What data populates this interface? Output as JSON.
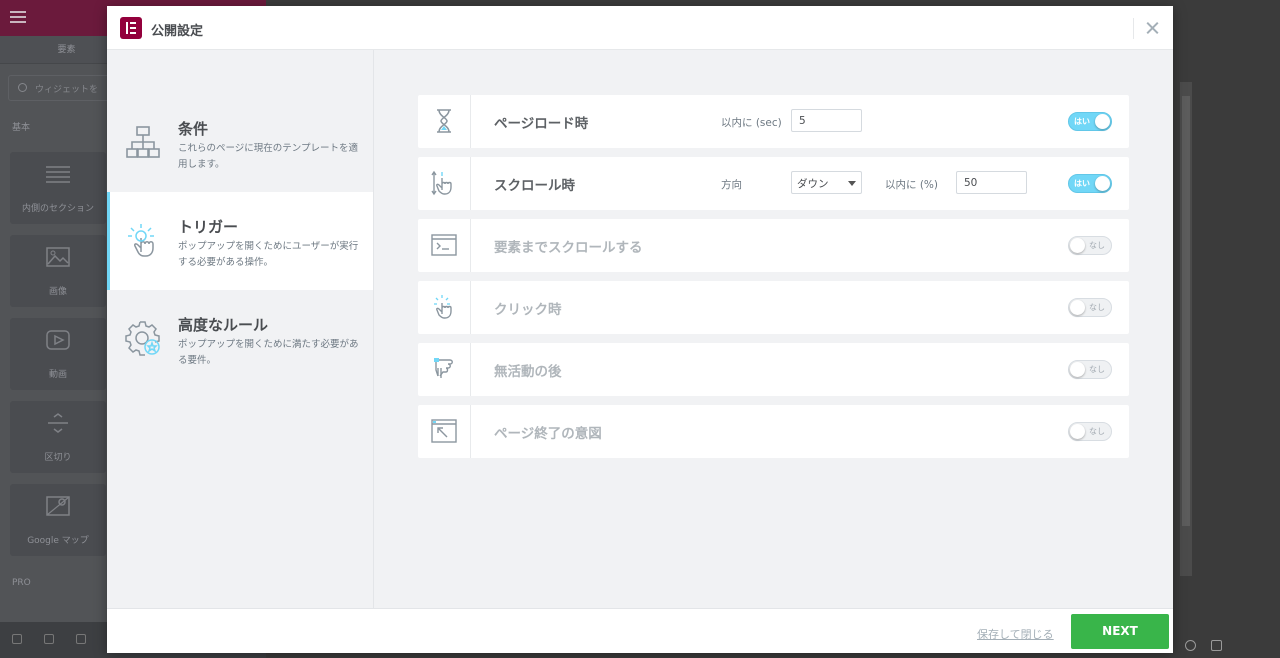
{
  "background": {
    "panel_tabs": [
      "要素",
      ""
    ],
    "search_placeholder": "ウィジェットを",
    "section_basic": "基本",
    "widgets": [
      {
        "label": "内側のセクション",
        "icon": "inner-section-icon"
      },
      {
        "label": "画像",
        "icon": "image-icon"
      },
      {
        "label": "動画",
        "icon": "video-icon"
      },
      {
        "label": "区切り",
        "icon": "divider-icon"
      },
      {
        "label": "Google マップ",
        "icon": "map-icon"
      }
    ],
    "section_pro": "PRO"
  },
  "modal": {
    "title": "公開設定",
    "close_icon": "close-icon",
    "sidebar": [
      {
        "title": "条件",
        "description": "これらのページに現在のテンプレートを適用します。",
        "icon": "sitemap-icon",
        "active": false
      },
      {
        "title": "トリガー",
        "description": "ポップアップを開くためにユーザーが実行する必要がある操作。",
        "icon": "click-hand-icon",
        "active": true
      },
      {
        "title": "高度なルール",
        "description": "ポップアップを開くために満たす必要がある要件。",
        "icon": "gear-star-icon",
        "active": false
      }
    ],
    "triggers": [
      {
        "label": "ページロード時",
        "icon": "hourglass-icon",
        "enabled": true,
        "toggle_text": "はい",
        "fields": {
          "delay_label": "以内に (sec)",
          "delay_value": "5"
        }
      },
      {
        "label": "スクロール時",
        "icon": "scroll-hand-icon",
        "enabled": true,
        "toggle_text": "はい",
        "fields": {
          "direction_label": "方向",
          "direction_value": "ダウン",
          "percent_label": "以内に (%)",
          "percent_value": "50"
        }
      },
      {
        "label": "要素までスクロールする",
        "icon": "scroll-to-element-icon",
        "enabled": false,
        "toggle_text": "なし"
      },
      {
        "label": "クリック時",
        "icon": "click-icon",
        "enabled": false,
        "toggle_text": "なし"
      },
      {
        "label": "無活動の後",
        "icon": "inactivity-hand-icon",
        "enabled": false,
        "toggle_text": "なし"
      },
      {
        "label": "ページ終了の意図",
        "icon": "exit-intent-icon",
        "enabled": false,
        "toggle_text": "なし"
      }
    ],
    "footer": {
      "save_close": "保存して閉じる",
      "next": "NEXT"
    }
  },
  "colors": {
    "brand": "#93003c",
    "accent": "#71d7f7",
    "next_button": "#39b54a"
  }
}
